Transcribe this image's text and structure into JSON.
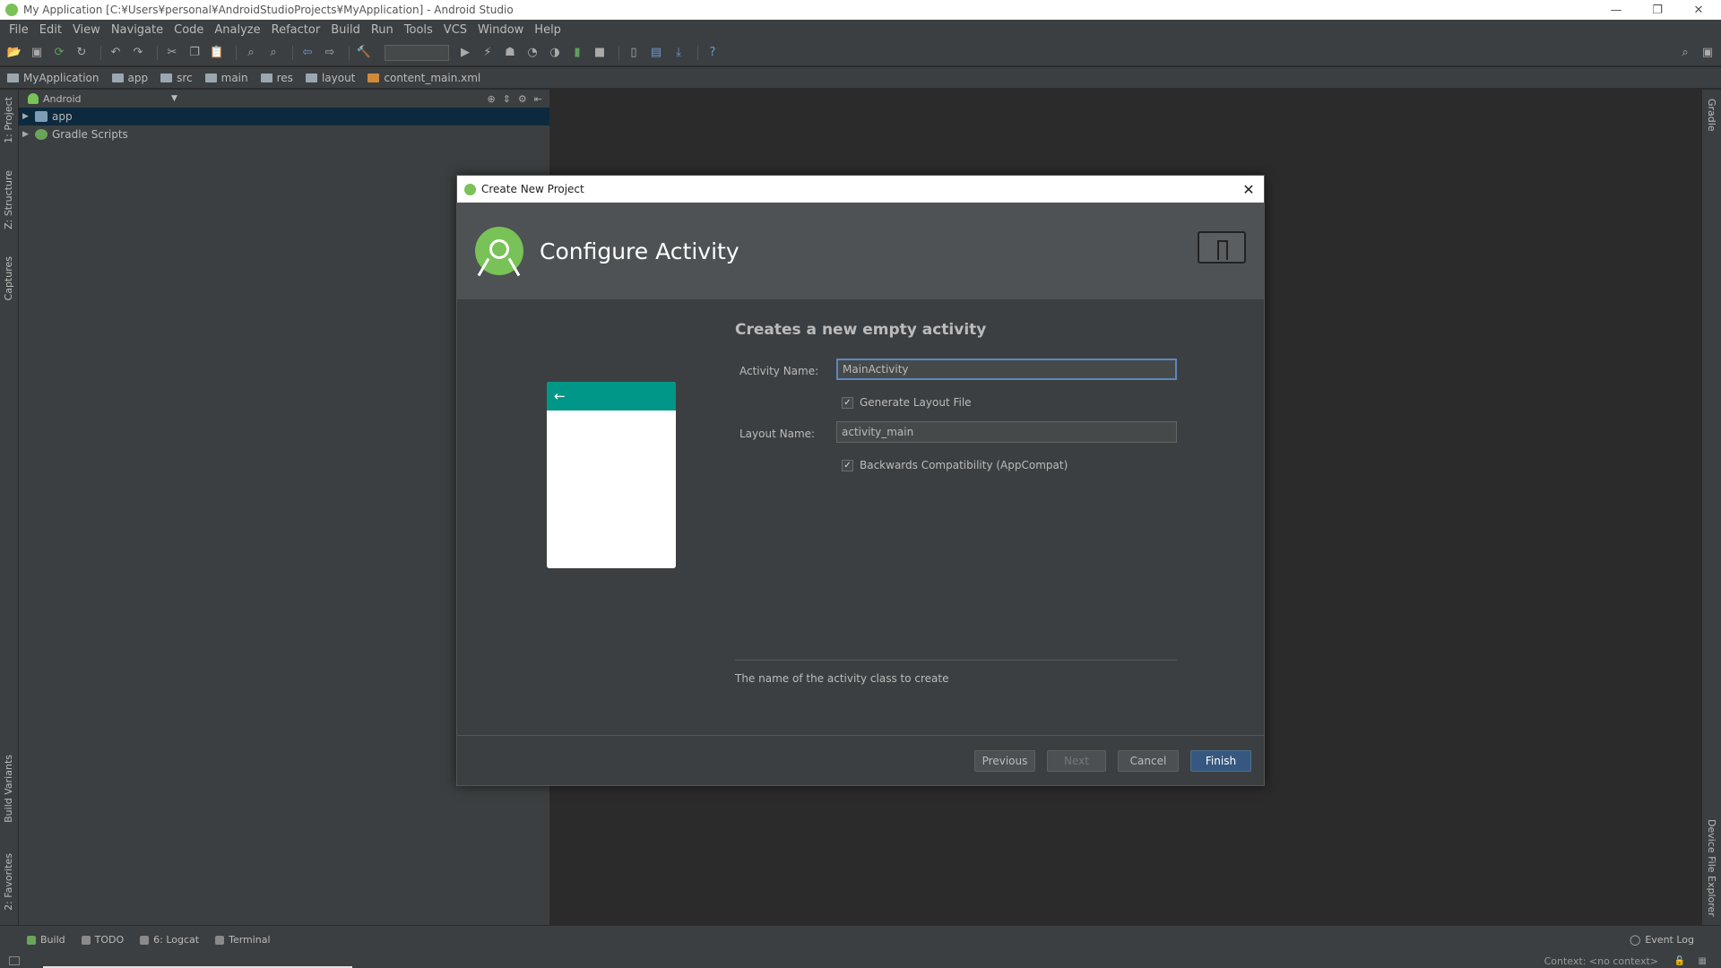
{
  "window": {
    "title": "My Application [C:¥Users¥personal¥AndroidStudioProjects¥MyApplication] - Android Studio",
    "minimize": "—",
    "restore": "❐",
    "close": "✕"
  },
  "menu": [
    "File",
    "Edit",
    "View",
    "Navigate",
    "Code",
    "Analyze",
    "Refactor",
    "Build",
    "Run",
    "Tools",
    "VCS",
    "Window",
    "Help"
  ],
  "breadcrumb": [
    "MyApplication",
    "app",
    "src",
    "main",
    "res",
    "layout",
    "content_main.xml"
  ],
  "left_tabs": {
    "project": "1: Project",
    "structure": "Z: Structure",
    "captures": "Captures",
    "build_variants": "Build Variants",
    "favorites": "2: Favorites"
  },
  "right_tabs": {
    "gradle": "Gradle",
    "device_explorer": "Device File Explorer"
  },
  "project_panel": {
    "view_mode": "Android",
    "tree": [
      "app",
      "Gradle Scripts"
    ]
  },
  "bottom_tabs": [
    "Build",
    "TODO",
    "6: Logcat",
    "Terminal"
  ],
  "event_log": "Event Log",
  "status": {
    "context": "Context: <no context>"
  },
  "dialog": {
    "title": "Create New Project",
    "header": "Configure Activity",
    "subtitle": "Creates a new empty activity",
    "activity_name_label": "Activity Name:",
    "activity_name_value": "MainActivity",
    "generate_layout_label": "Generate Layout File",
    "generate_layout_checked": true,
    "layout_name_label": "Layout Name:",
    "layout_name_value": "activity_main",
    "backwards_compat_label": "Backwards Compatibility (AppCompat)",
    "backwards_compat_checked": true,
    "hint": "The name of the activity class to create",
    "buttons": {
      "previous": "Previous",
      "next": "Next",
      "cancel": "Cancel",
      "finish": "Finish"
    },
    "check_glyph": "✓",
    "back_arrow": "←"
  },
  "colors": {
    "accent": "#365880",
    "android_green": "#78c257",
    "preview_toolbar": "#009688"
  }
}
